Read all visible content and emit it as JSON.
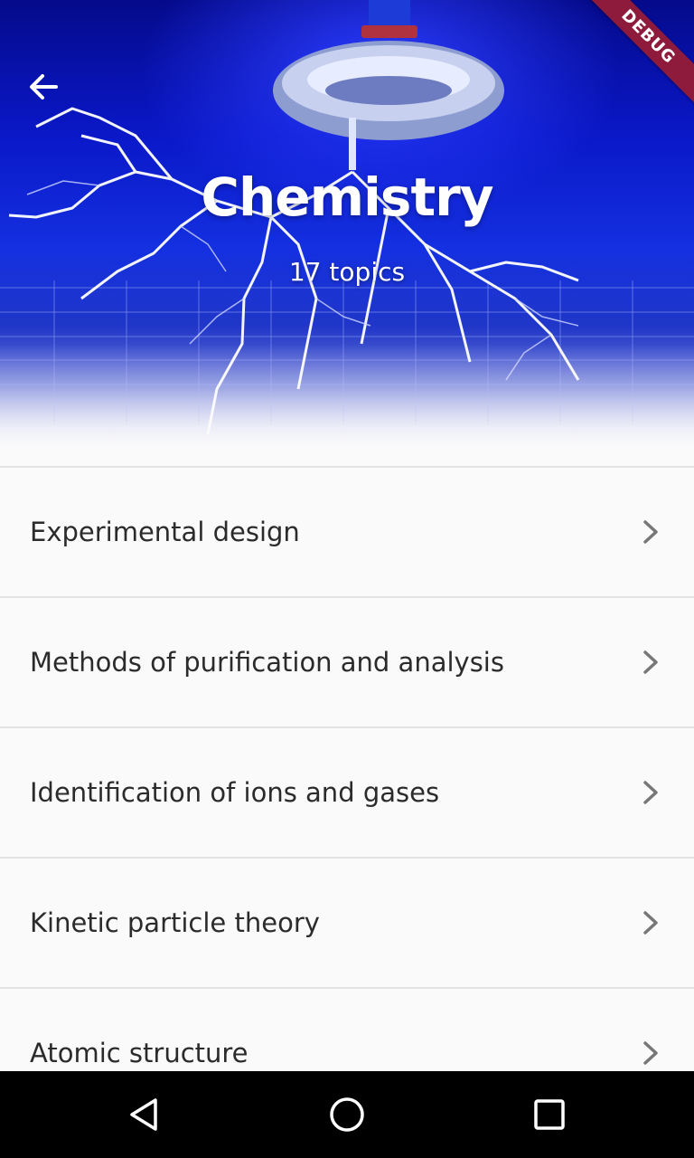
{
  "header": {
    "title": "Chemistry",
    "subtitle": "17 topics",
    "back_icon": "arrow-left-icon",
    "debug_label": "DEBUG"
  },
  "topics": [
    {
      "label": "Experimental design"
    },
    {
      "label": "Methods of purification and analysis"
    },
    {
      "label": "Identification of ions and gases"
    },
    {
      "label": "Kinetic particle theory"
    },
    {
      "label": "Atomic structure"
    }
  ],
  "nav": {
    "back_icon": "triangle-back-icon",
    "home_icon": "circle-home-icon",
    "recents_icon": "square-recents-icon"
  },
  "colors": {
    "accent": "#1430e0",
    "debug_ribbon": "#8e1b3c",
    "text": "#2b2b2b",
    "divider": "#e3e3e3",
    "chevron": "#777777"
  }
}
